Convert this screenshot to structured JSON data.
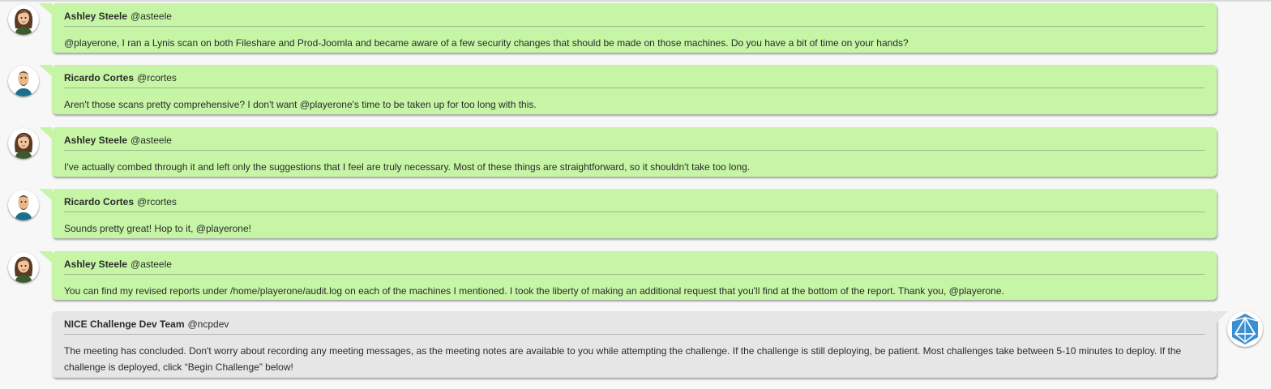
{
  "messages": [
    {
      "name": "Ashley Steele",
      "handle": "@asteele",
      "avatar": "ashley-avatar",
      "text": "@playerone, I ran a Lynis scan on both Fileshare and Prod-Joomla and became aware of a few security changes that should be made on those machines. Do you have a bit of time on your hands?"
    },
    {
      "name": "Ricardo Cortes",
      "handle": "@rcortes",
      "avatar": "ricardo-avatar",
      "text": "Aren't those scans pretty comprehensive? I don't want @playerone's time to be taken up for too long with this."
    },
    {
      "name": "Ashley Steele",
      "handle": "@asteele",
      "avatar": "ashley-avatar",
      "text": "I've actually combed through it and left only the suggestions that I feel are truly necessary. Most of these things are straightforward, so it shouldn't take too long."
    },
    {
      "name": "Ricardo Cortes",
      "handle": "@rcortes",
      "avatar": "ricardo-avatar",
      "text": "Sounds pretty great! Hop to it, @playerone!"
    },
    {
      "name": "Ashley Steele",
      "handle": "@asteele",
      "avatar": "ashley-avatar",
      "text": "You can find my revised reports under /home/playerone/audit.log on each of the machines I mentioned. I took the liberty of making an additional request that you'll find at the bottom of the report. Thank you, @playerone."
    },
    {
      "name": "NICE Challenge Dev Team",
      "handle": "@ncpdev",
      "avatar": "nice-logo-icon",
      "text": "The meeting has concluded. Don't worry about recording any meeting messages, as the meeting notes are available to you while attempting the challenge. If the challenge is still deploying, be patient. Most challenges take between 5-10 minutes to deploy. If the challenge is deployed, click “Begin Challenge” below!"
    }
  ],
  "colors": {
    "user_bubble": "#c5f5a5",
    "system_bubble": "#e6e6e6",
    "logo": "#3a8fd1"
  }
}
